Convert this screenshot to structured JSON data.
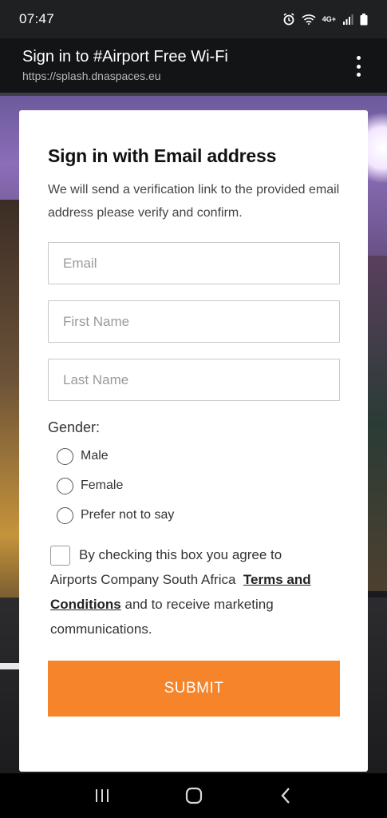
{
  "status_bar": {
    "time": "07:47",
    "network": "4G+"
  },
  "browser": {
    "title": "Sign in to #Airport Free Wi-Fi",
    "url": "https://splash.dnaspaces.eu"
  },
  "form": {
    "title": "Sign in with Email address",
    "description": "We will send a verification link to the provided email address please verify and confirm.",
    "email_placeholder": "Email",
    "first_name_placeholder": "First Name",
    "last_name_placeholder": "Last Name",
    "gender_label": "Gender:",
    "gender_options": [
      "Male",
      "Female",
      "Prefer not to say"
    ],
    "consent_before": "By checking this box you agree to",
    "consent_company": "Airports Company South Africa",
    "terms_link": "Terms and Conditions",
    "consent_after": "and to receive marketing communications.",
    "submit_label": "SUBMIT"
  },
  "colors": {
    "accent": "#f5842a",
    "card": "#ffffff"
  }
}
